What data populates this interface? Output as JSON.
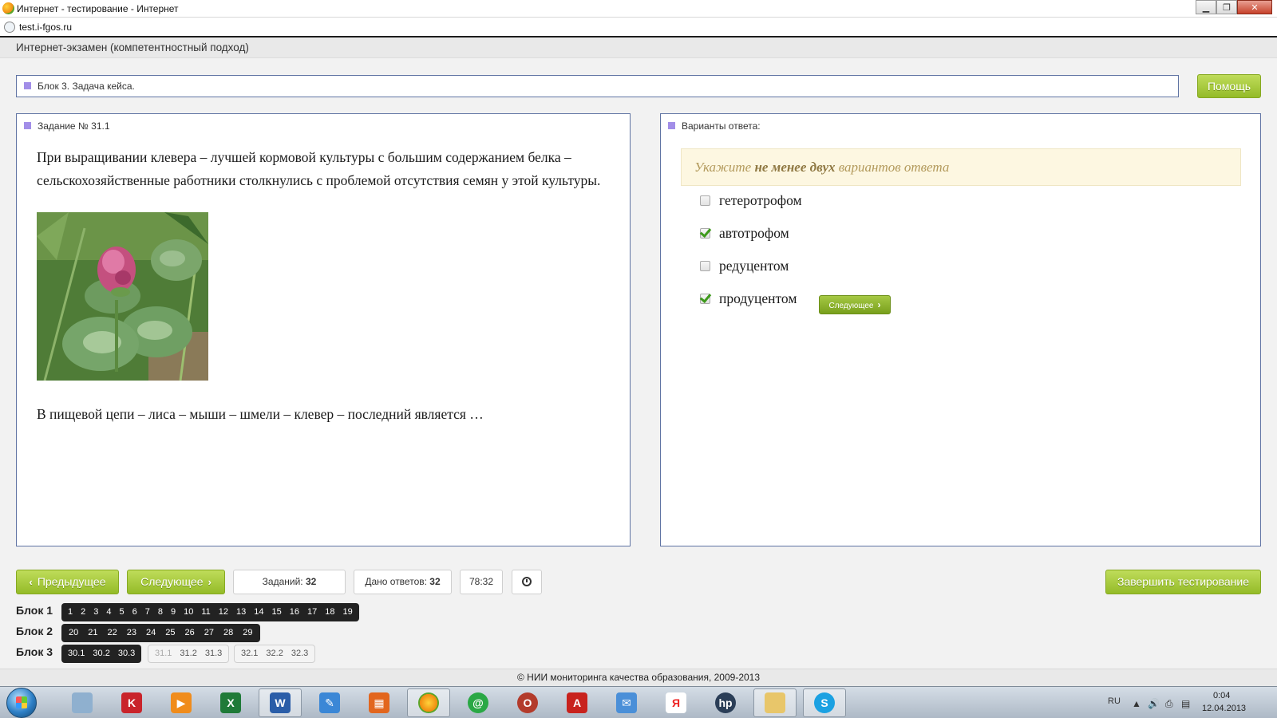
{
  "window": {
    "title": "Интернет - тестирование - Интернет",
    "url": "test.i-fgos.ru"
  },
  "header": {
    "title": "Интернет-экзамен (компетентностный подход)"
  },
  "block_bar": {
    "label": "Блок 3. Задача кейса.",
    "help_label": "Помощь"
  },
  "task": {
    "heading": "Задание № 31.1",
    "text": "При выращивании клевера – лучшей кормовой культуры с большим содержанием белка – сельскохозяйственные работники столкнулись с проблемой отсутствия семян у этой культуры.",
    "question": "В пищевой цепи – лиса – мыши – шмели – клевер – последний является …"
  },
  "answers": {
    "heading": "Варианты ответа:",
    "hint_before": "Укажите",
    "hint_bold": "не менее двух",
    "hint_after": "вариантов ответа",
    "options": [
      {
        "label": "гетеротрофом",
        "checked": false
      },
      {
        "label": "автотрофом",
        "checked": true
      },
      {
        "label": "редуцентом",
        "checked": false
      },
      {
        "label": "продуцентом",
        "checked": true
      }
    ],
    "next_small_label": "Следующее"
  },
  "controls": {
    "prev_label": "Предыдущее",
    "next_label": "Следующее",
    "tasks_label": "Заданий:",
    "tasks_value": "32",
    "answered_label": "Дано ответов:",
    "answered_value": "32",
    "time": "78:32",
    "finish_label": "Завершить тестирование"
  },
  "blocks": [
    {
      "label": "Блок 1",
      "groups": [
        {
          "style": "dark",
          "items": [
            "1",
            "2",
            "3",
            "4",
            "5",
            "6",
            "7",
            "8",
            "9",
            "10",
            "11",
            "12",
            "13",
            "14",
            "15",
            "16",
            "17",
            "18",
            "19"
          ]
        }
      ]
    },
    {
      "label": "Блок 2",
      "groups": [
        {
          "style": "dark",
          "items": [
            "20",
            "21",
            "22",
            "23",
            "24",
            "25",
            "26",
            "27",
            "28",
            "29"
          ]
        }
      ]
    },
    {
      "label": "Блок 3",
      "groups": [
        {
          "style": "dark",
          "items": [
            "30.1",
            "30.2",
            "30.3"
          ]
        },
        {
          "style": "light",
          "items": [
            "31.1",
            "31.2",
            "31.3"
          ]
        },
        {
          "style": "light",
          "items": [
            "32.1",
            "32.2",
            "32.3"
          ]
        }
      ]
    }
  ],
  "footer": "© НИИ мониторинга качества образования, 2009-2013",
  "taskbar": {
    "lang": "RU",
    "time": "0:04",
    "date": "12.04.2013",
    "apps": [
      "calculator-icon",
      "kaspersky-icon",
      "media-player-icon",
      "excel-icon",
      "word-icon",
      "notepad-icon",
      "office-icon",
      "browser-icon",
      "mail-agent-icon",
      "opera-icon",
      "acrobat-icon",
      "outlook-icon",
      "yandex-icon",
      "hp-icon",
      "folder-icon",
      "skype-icon"
    ]
  },
  "colors": {
    "accent_green": "#9bc12f",
    "panel_border": "#5f73a3",
    "square_marker": "#a28ee8",
    "hint_bg": "#fdf7e1",
    "hint_text": "#b39a5c"
  }
}
